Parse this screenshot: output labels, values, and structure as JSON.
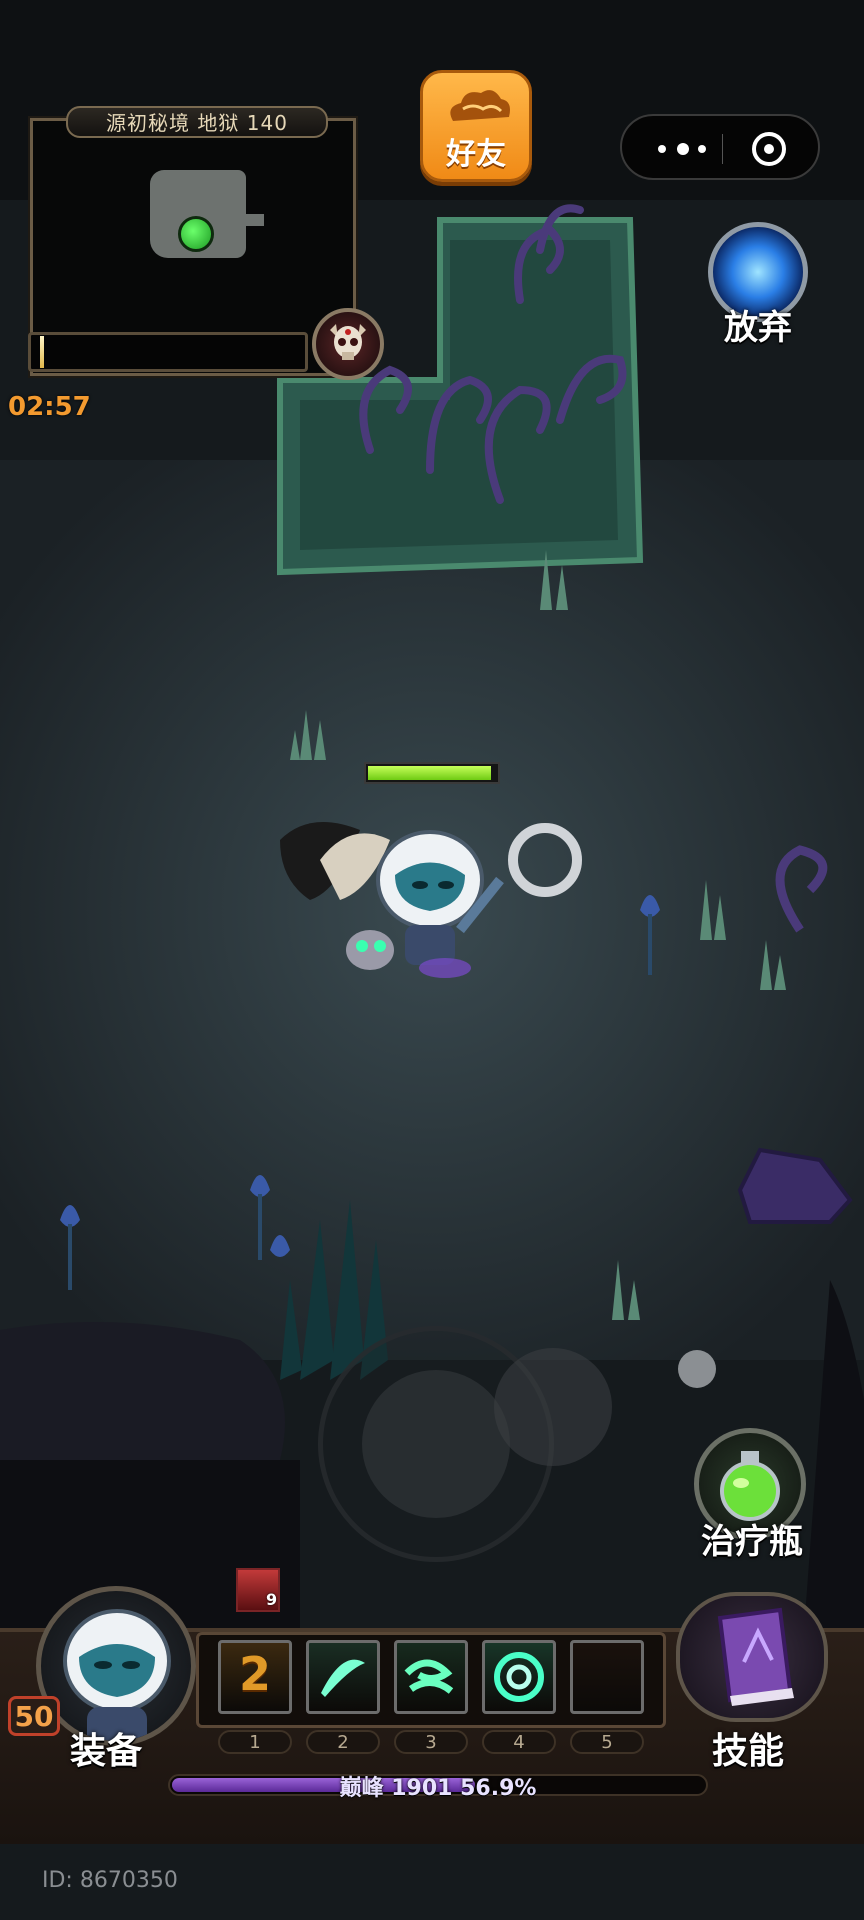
{
  "minimap": {
    "title": "源初秘境 地狱 140",
    "timer": "02:57",
    "progress": 0.01
  },
  "top": {
    "friend_label": "好友",
    "giveup_label": "放弃"
  },
  "player": {
    "hp_fraction": 0.96
  },
  "right_side": {
    "potion_label": "治疗瓶"
  },
  "buff": {
    "count": "9"
  },
  "skill_slots": [
    {
      "num": "1",
      "content": "2",
      "icon": "counter-skill-icon",
      "color": "#e09a28"
    },
    {
      "num": "2",
      "content": "",
      "icon": "slash-skill-icon",
      "color": "#38b08a"
    },
    {
      "num": "3",
      "content": "",
      "icon": "wind-skill-icon",
      "color": "#2aa06e"
    },
    {
      "num": "4",
      "content": "",
      "icon": "vortex-skill-icon",
      "color": "#2fd6a0"
    },
    {
      "num": "5",
      "content": "",
      "icon": "empty-slot",
      "color": "#3a2218"
    }
  ],
  "bottom": {
    "level": "50",
    "equip_label": "装备",
    "skill_label": "技能",
    "xp_text": "巅峰 1901 56.9%",
    "xp_fraction": 0.569,
    "player_id": "ID: 8670350"
  },
  "colors": {
    "timer": "#f39a2f",
    "friend_button": "#f59a25",
    "hp": "#8be02a",
    "xp": "#8a55c8"
  }
}
